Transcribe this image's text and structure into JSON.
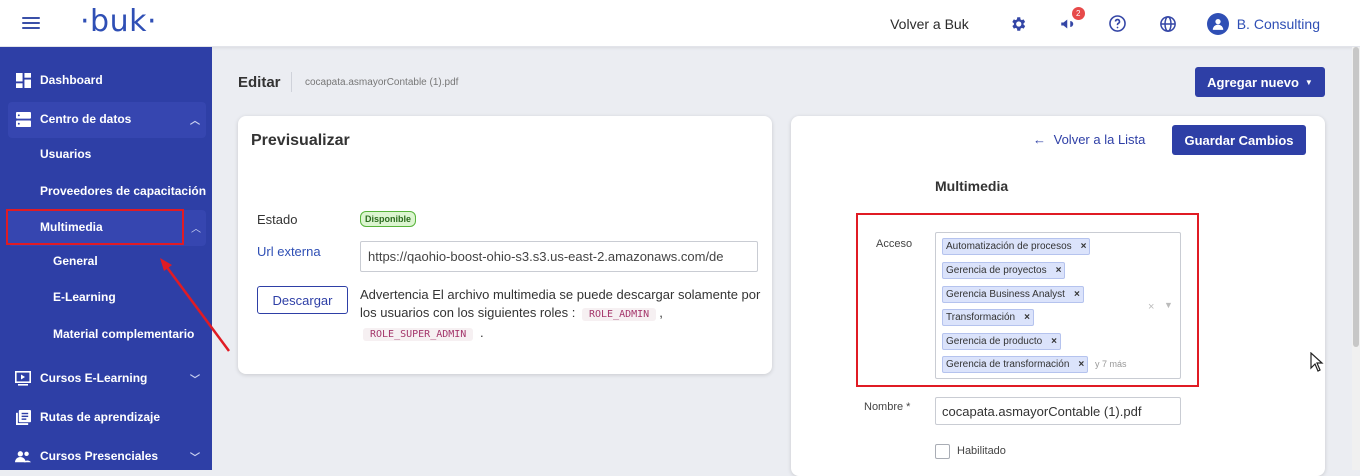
{
  "topbar": {
    "logo": "·buk·",
    "volver": "Volver a Buk",
    "notifications_count": "2",
    "user_name": "B. Consulting",
    "icons": [
      "menu-icon",
      "gear-icon",
      "megaphone-icon",
      "help-icon",
      "globe-icon",
      "user-icon"
    ]
  },
  "sidebar": {
    "dashboard": "Dashboard",
    "centro_datos": "Centro de datos",
    "usuarios": "Usuarios",
    "proveedores": "Proveedores de capacitación",
    "multimedia": "Multimedia",
    "general": "General",
    "elearning": "E-Learning",
    "material": "Material complementario",
    "cursos_elearning": "Cursos E-Learning",
    "rutas": "Rutas de aprendizaje",
    "cursos_presenciales": "Cursos Presenciales"
  },
  "header": {
    "title": "Editar",
    "file": "cocapata.asmayorContable (1).pdf",
    "agregar": "Agregar nuevo"
  },
  "preview": {
    "title": "Previsualizar",
    "estado_label": "Estado",
    "estado_value": "Disponible",
    "url_label": "Url externa",
    "url_value": "https://qaohio-boost-ohio-s3.s3.us-east-2.amazonaws.com/de",
    "descargar": "Descargar",
    "warning_text": "Advertencia El archivo multimedia se puede descargar solamente por los usuarios con los siguientes roles :",
    "role1": "ROLE_ADMIN",
    "comma": ",",
    "role2": "ROLE_SUPER_ADMIN",
    "period": "."
  },
  "form": {
    "volver_lista": "Volver a la Lista",
    "guardar": "Guardar Cambios",
    "section_title": "Multimedia",
    "acceso_label": "Acceso",
    "tags": [
      "Automatización de procesos",
      "Gerencia de proyectos",
      "Gerencia Business Analyst",
      "Transformación",
      "Gerencia de producto",
      "Gerencia de transformación"
    ],
    "more": "y 7 más",
    "nombre_label": "Nombre *",
    "nombre_value": "cocapata.asmayorContable (1).pdf",
    "habilitado": "Habilitado"
  },
  "colors": {
    "primary": "#2e3fa6",
    "highlight": "#e01b24",
    "badge": "#e74a4a"
  }
}
